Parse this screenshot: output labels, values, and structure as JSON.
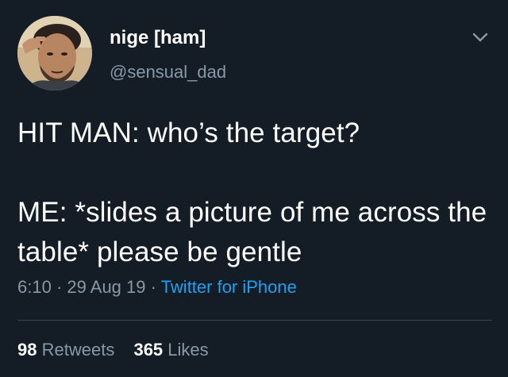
{
  "theme": {
    "background": "#141d26",
    "text": "#ffffff",
    "secondary": "#8899a6",
    "link": "#1da1f2",
    "divider": "#38444d"
  },
  "author": {
    "display_name": "nige [ham]",
    "handle": "@sensual_dad",
    "avatar_icon": "profile-photo"
  },
  "menu_icon": "chevron-down-icon",
  "tweet": {
    "text": "HIT MAN: who’s the target?\n\nME: *slides a picture of me across the table* please be gentle"
  },
  "meta": {
    "time": "6:10",
    "separator": "·",
    "date": "29 Aug 19",
    "source": "Twitter for iPhone"
  },
  "stats": {
    "retweets_count": "98",
    "retweets_label": "Retweets",
    "likes_count": "365",
    "likes_label": "Likes"
  }
}
